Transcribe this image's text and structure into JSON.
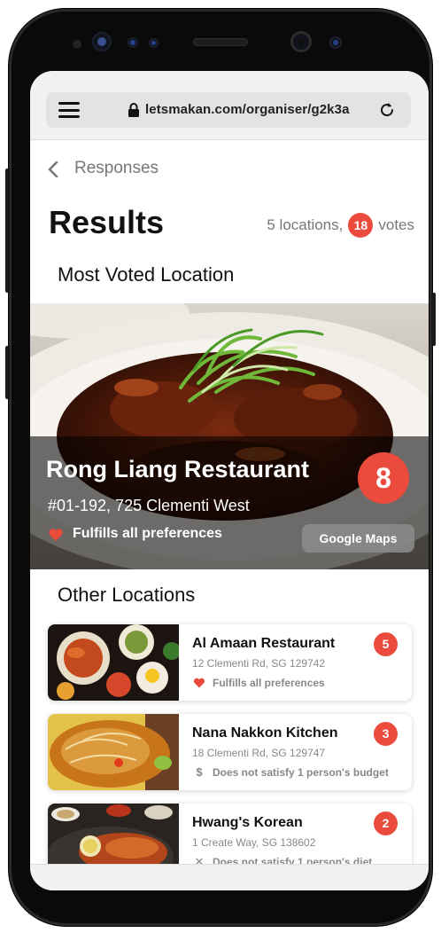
{
  "browser": {
    "url": "letsmakan.com/organiser/g2k3a"
  },
  "header": {
    "back_label": "Responses",
    "title": "Results",
    "locations_text": "5 locations,",
    "votes_count": "18",
    "votes_label": "votes"
  },
  "sections": {
    "most_voted": "Most Voted Location",
    "other": "Other Locations"
  },
  "top_location": {
    "name": "Rong Liang Restaurant",
    "address": "#01-192, 725 Clementi West",
    "preference_note": "Fulfills all preferences",
    "votes": "8",
    "maps_label": "Google Maps"
  },
  "other_locations": [
    {
      "name": "Al Amaan Restaurant",
      "address": "12 Clementi Rd, SG 129742",
      "note": "Fulfills all preferences",
      "note_icon": "heart-icon",
      "votes": "5"
    },
    {
      "name": "Nana Nakkon Kitchen",
      "address": "18 Clementi Rd, SG 129747",
      "note": "Does not satisfy 1 person's budget",
      "note_icon": "dollar-icon",
      "votes": "3"
    },
    {
      "name": "Hwang's Korean",
      "address": "1 Create Way, SG 138602",
      "note": "Does not satisfy 1 person's diet",
      "note_icon": "cross-icon",
      "votes": "2"
    }
  ],
  "icons": {
    "dollar": "$",
    "cross": "✕"
  },
  "colors": {
    "accent": "#ea4b3c",
    "muted_text": "#777777"
  }
}
